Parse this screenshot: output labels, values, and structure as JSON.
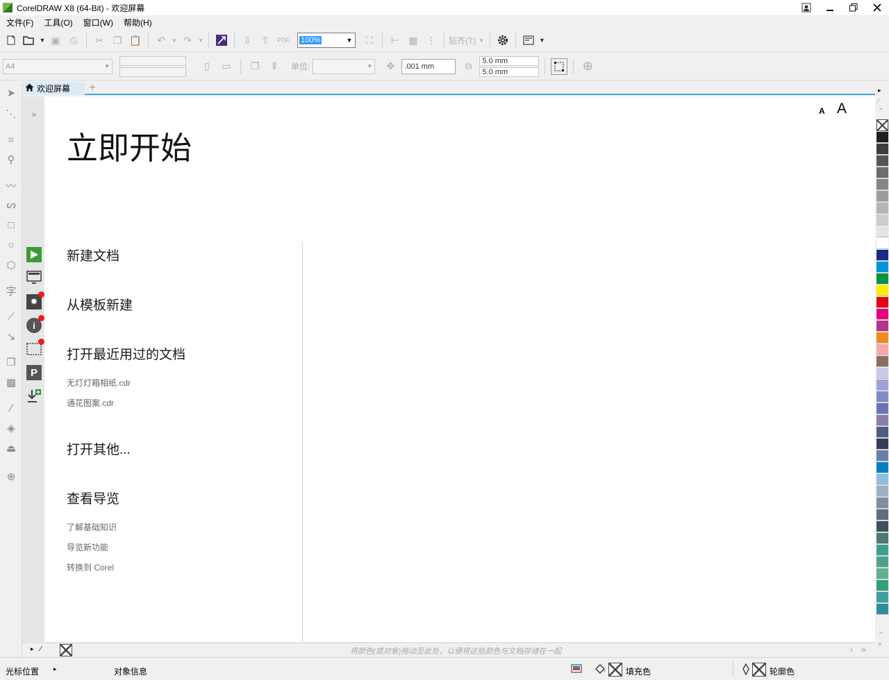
{
  "window": {
    "title": "CorelDRAW X8 (64-Bit) - 欢迎屏幕"
  },
  "menu": [
    "文件(F)",
    "工具(O)",
    "窗口(W)",
    "帮助(H)"
  ],
  "toolbar": {
    "zoom_value": "100%",
    "snap_label": "贴齐(T)"
  },
  "property_bar": {
    "page_size": "A4",
    "units_label": "单位:",
    "nudge_value": ".001 mm",
    "dup_x": "5.0 mm",
    "dup_y": "5.0 mm"
  },
  "tabs": [
    {
      "label": "欢迎屏幕",
      "active": true
    }
  ],
  "welcome": {
    "font_small": "A",
    "font_large": "A",
    "heading": "立即开始",
    "new_document": "新建文档",
    "new_from_template": "从模板新建",
    "open_recent": "打开最近用过的文档",
    "recent_files": [
      "无灯灯箱相纸.cdr",
      "通花图案.cdr"
    ],
    "open_other": "打开其他...",
    "view_tour": "查看导览",
    "tour_links": [
      "了解基础知识",
      "导览新功能",
      "转换到 Corel"
    ]
  },
  "document_palette": {
    "hint": "将颜色(或对象)拖动至此处，以便将这些颜色与文档存储在一起"
  },
  "status": {
    "cursor_position": "光标位置",
    "object_info": "对象信息",
    "fill_label": "填充色",
    "outline_label": "轮廓色"
  },
  "palette_colors": [
    "#231f20",
    "#3d3d3d",
    "#555555",
    "#6d6d6d",
    "#858585",
    "#9d9d9d",
    "#b5b5b5",
    "#cdcdcd",
    "#e5e5e5",
    "#ffffff",
    "#1b2a87",
    "#0096d6",
    "#009245",
    "#ffed00",
    "#e30613",
    "#e6007e",
    "#b5338a",
    "#f08a1f",
    "#f4a9a8",
    "#8c6e5d",
    "#c8c8e8",
    "#a1a1d4",
    "#7f8cc8",
    "#6a74b4",
    "#8a7fa8",
    "#4d5d87",
    "#3a3a58",
    "#6a7fa8",
    "#0080c0",
    "#8fbfe0",
    "#9fb0c0",
    "#7f8f9f",
    "#5f6f7f",
    "#3f4f5f",
    "#4a7a72",
    "#3f9f8f",
    "#4fa08f",
    "#5fb08f",
    "#2f9f7f",
    "#3fa0a0",
    "#2f8f9f"
  ]
}
